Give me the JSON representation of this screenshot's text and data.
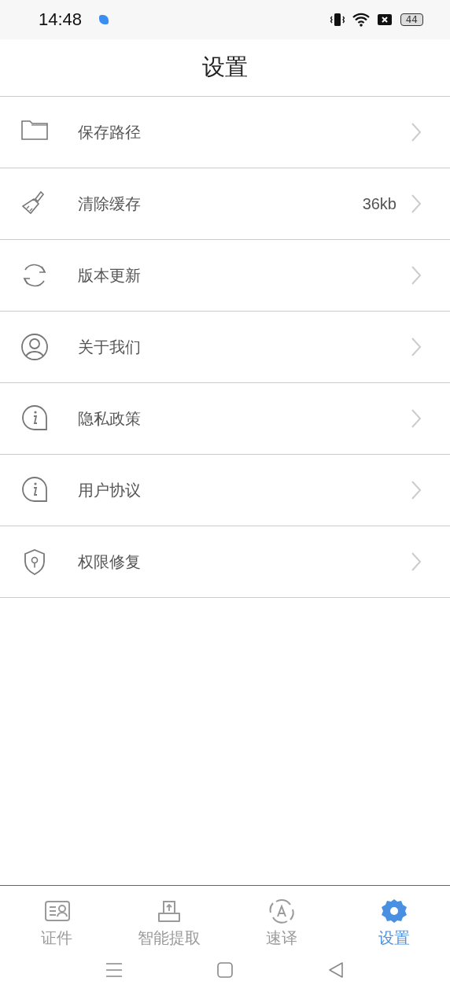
{
  "status_bar": {
    "time": "14:48",
    "battery": "44"
  },
  "header": {
    "title": "设置"
  },
  "settings": [
    {
      "kind": "folder",
      "label": "保存路径"
    },
    {
      "kind": "brush",
      "label": "清除缓存",
      "value": "36kb"
    },
    {
      "kind": "refresh",
      "label": "版本更新"
    },
    {
      "kind": "person",
      "label": "关于我们"
    },
    {
      "kind": "info",
      "label": "隐私政策"
    },
    {
      "kind": "info",
      "label": "用户协议"
    },
    {
      "kind": "shield",
      "label": "权限修复"
    }
  ],
  "tabs": [
    {
      "kind": "card",
      "label": "证件",
      "selected": false
    },
    {
      "kind": "upload",
      "label": "智能提取",
      "selected": false
    },
    {
      "kind": "translate",
      "label": "速译",
      "selected": false
    },
    {
      "kind": "gear",
      "label": "设置",
      "selected": true
    }
  ]
}
